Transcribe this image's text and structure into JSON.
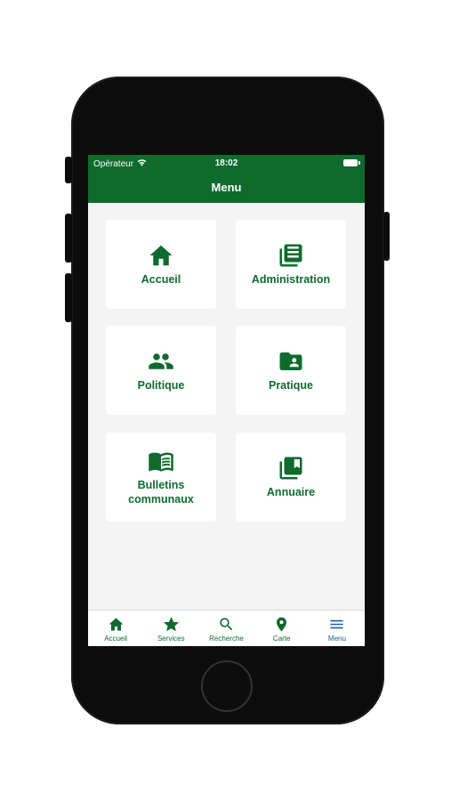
{
  "status_bar": {
    "carrier": "Opérateur",
    "time": "18:02"
  },
  "nav": {
    "title": "Menu"
  },
  "tiles": [
    {
      "label": "Accueil",
      "icon": "home-icon"
    },
    {
      "label": "Administration",
      "icon": "newspaper-icon"
    },
    {
      "label": "Politique",
      "icon": "people-icon"
    },
    {
      "label": "Pratique",
      "icon": "contact-folder-icon"
    },
    {
      "label": "Bulletins communaux",
      "icon": "open-book-icon"
    },
    {
      "label": "Annuaire",
      "icon": "bookmark-library-icon"
    }
  ],
  "tab_bar": {
    "items": [
      {
        "label": "Accueil",
        "icon": "home-icon"
      },
      {
        "label": "Services",
        "icon": "star-icon"
      },
      {
        "label": "Recherche",
        "icon": "search-icon"
      },
      {
        "label": "Carte",
        "icon": "map-pin-icon"
      },
      {
        "label": "Menu",
        "icon": "hamburger-menu-icon",
        "active": true
      }
    ]
  },
  "colors": {
    "brand_green": "#0e6b2d",
    "active_tab": "#1f5aa6",
    "screen_background": "#f4f4f4"
  }
}
